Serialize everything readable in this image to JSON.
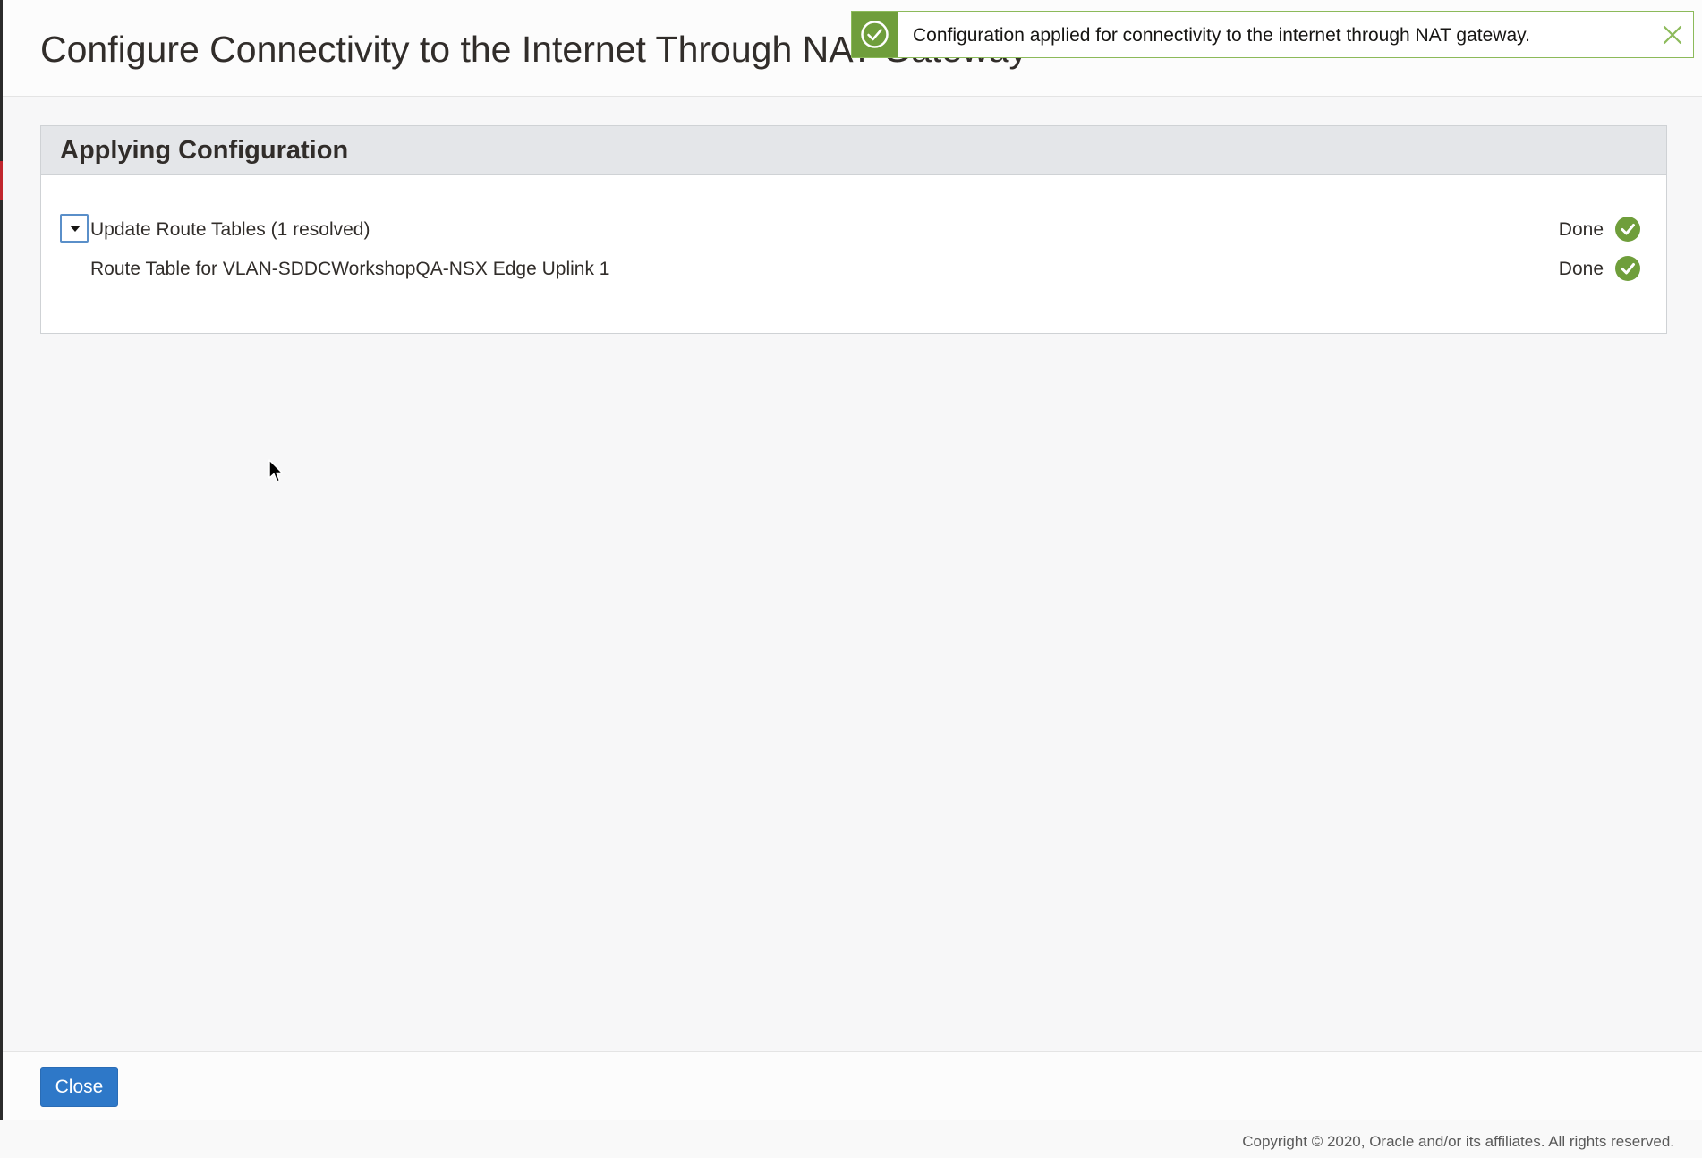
{
  "dialog": {
    "title": "Configure Connectivity to the Internet Through NAT Gateway"
  },
  "panel": {
    "title": "Applying Configuration",
    "rows": [
      {
        "label": "Update Route Tables (1 resolved)",
        "status": "Done",
        "expanded": true
      },
      {
        "label": "Route Table for VLAN-SDDCWorkshopQA-NSX Edge Uplink 1",
        "status": "Done"
      }
    ]
  },
  "footer": {
    "close_label": "Close"
  },
  "toast": {
    "message": "Configuration applied for connectivity to the internet through NAT gateway.",
    "icon": "success-check-icon"
  },
  "page_footer": {
    "copyright": "Copyright © 2020, Oracle and/or its affiliates. All rights reserved."
  },
  "colors": {
    "success": "#6f9e3b",
    "primary_button": "#2e78c8",
    "toast_border": "#8cba5a"
  }
}
